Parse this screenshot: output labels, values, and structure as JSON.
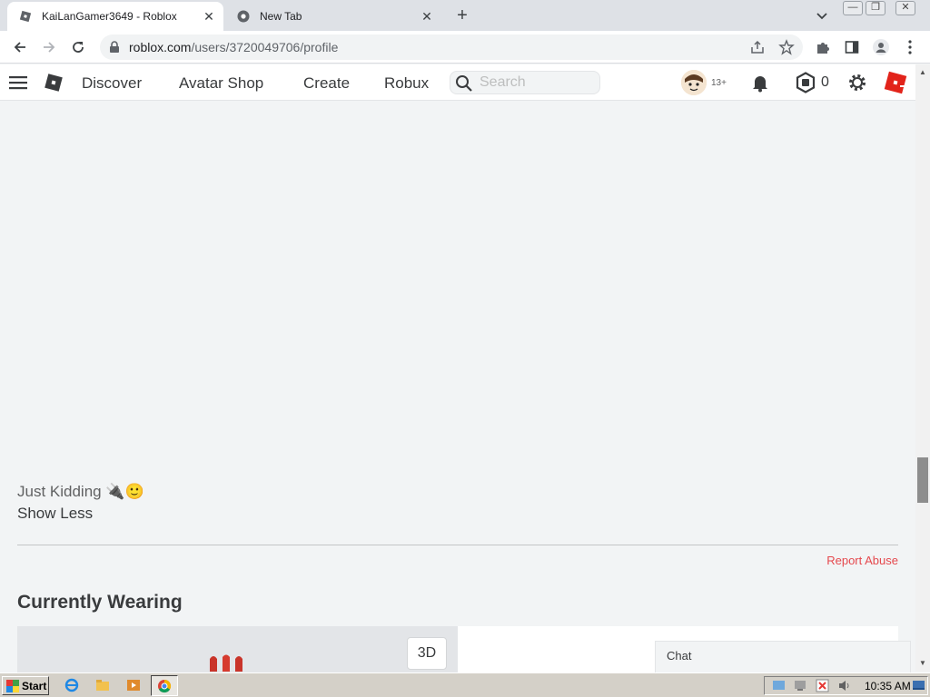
{
  "browser": {
    "tabs": [
      {
        "title": "KaiLanGamer3649 - Roblox",
        "active": true
      },
      {
        "title": "New Tab",
        "active": false
      }
    ],
    "new_tab_label": "+",
    "close_label": "✕",
    "url_host": "roblox.com",
    "url_path": "/users/3720049706/profile"
  },
  "header": {
    "nav": [
      "Discover",
      "Avatar Shop",
      "Create",
      "Robux"
    ],
    "search_placeholder": "Search",
    "age_badge": "13+",
    "robux_count": "0"
  },
  "profile": {
    "about_text": "Just Kidding 🔌🙂",
    "show_less": "Show Less",
    "report_abuse": "Report Abuse",
    "currently_wearing": "Currently Wearing",
    "btn_3d": "3D",
    "chat_label": "Chat"
  },
  "taskbar": {
    "start_label": "Start",
    "clock": "10:35 AM"
  },
  "colors": {
    "accent_red": "#e5484d",
    "page_bg": "#f2f4f5"
  }
}
